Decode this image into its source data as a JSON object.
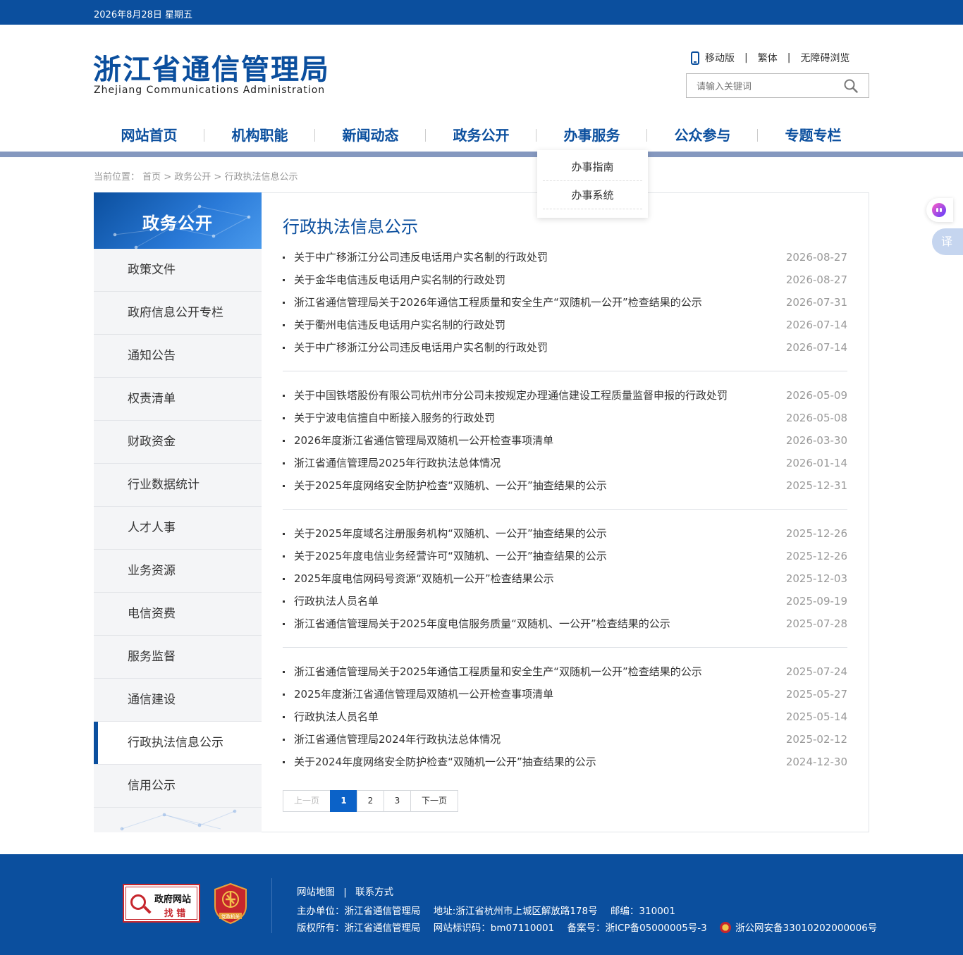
{
  "topbar": {
    "date": "2026年8月28日 星期五"
  },
  "header": {
    "logo_cn": "浙江省通信管理局",
    "logo_en": "Zhejiang Communications Administration",
    "links": {
      "mobile": "移动版",
      "traditional": "繁体",
      "accessible": "无障碍浏览"
    },
    "search_placeholder": "请输入关键词"
  },
  "nav": {
    "items": [
      "网站首页",
      "机构职能",
      "新闻动态",
      "政务公开",
      "办事服务",
      "公众参与",
      "专题专栏"
    ],
    "dropdown": [
      "办事指南",
      "办事系统"
    ]
  },
  "breadcrumb": "当前位置： 首页 > 政务公开 > 行政执法信息公示",
  "sidebar": {
    "title": "政务公开",
    "items": [
      "政策文件",
      "政府信息公开专栏",
      "通知公告",
      "权责清单",
      "财政资金",
      "行业数据统计",
      "人才人事",
      "业务资源",
      "电信资费",
      "服务监督",
      "通信建设",
      "行政执法信息公示",
      "信用公示"
    ],
    "active_index": 11
  },
  "main": {
    "title": "行政执法信息公示",
    "groups": [
      [
        {
          "title": "关于中广移浙江分公司违反电话用户实名制的行政处罚",
          "date": "2026-08-27"
        },
        {
          "title": "关于金华电信违反电话用户实名制的行政处罚",
          "date": "2026-08-27"
        },
        {
          "title": "浙江省通信管理局关于2026年通信工程质量和安全生产“双随机一公开”检查结果的公示",
          "date": "2026-07-31"
        },
        {
          "title": "关于衢州电信违反电话用户实名制的行政处罚",
          "date": "2026-07-14"
        },
        {
          "title": "关于中广移浙江分公司违反电话用户实名制的行政处罚",
          "date": "2026-07-14"
        }
      ],
      [
        {
          "title": "关于中国铁塔股份有限公司杭州市分公司未按规定办理通信建设工程质量监督申报的行政处罚",
          "date": "2026-05-09"
        },
        {
          "title": "关于宁波电信擅自中断接入服务的行政处罚",
          "date": "2026-05-08"
        },
        {
          "title": "2026年度浙江省通信管理局双随机一公开检查事项清单",
          "date": "2026-03-30"
        },
        {
          "title": "浙江省通信管理局2025年行政执法总体情况",
          "date": "2026-01-14"
        },
        {
          "title": "关于2025年度网络安全防护检查“双随机、一公开”抽查结果的公示",
          "date": "2025-12-31"
        }
      ],
      [
        {
          "title": "关于2025年度域名注册服务机构“双随机、一公开”抽查结果的公示",
          "date": "2025-12-26"
        },
        {
          "title": "关于2025年度电信业务经营许可“双随机、一公开”抽查结果的公示",
          "date": "2025-12-26"
        },
        {
          "title": "2025年度电信网码号资源“双随机一公开”检查结果公示",
          "date": "2025-12-03"
        },
        {
          "title": "行政执法人员名单",
          "date": "2025-09-19"
        },
        {
          "title": "浙江省通信管理局关于2025年度电信服务质量“双随机、一公开”检查结果的公示",
          "date": "2025-07-28"
        }
      ],
      [
        {
          "title": "浙江省通信管理局关于2025年通信工程质量和安全生产“双随机一公开”检查结果的公示",
          "date": "2025-07-24"
        },
        {
          "title": "2025年度浙江省通信管理局双随机一公开检查事项清单",
          "date": "2025-05-27"
        },
        {
          "title": "行政执法人员名单",
          "date": "2025-05-14"
        },
        {
          "title": "浙江省通信管理局2024年行政执法总体情况",
          "date": "2025-02-12"
        },
        {
          "title": "关于2024年度网络安全防护检查“双随机一公开”抽查结果的公示",
          "date": "2024-12-30"
        }
      ]
    ],
    "pager": {
      "prev": "上一页",
      "pages": [
        "1",
        "2",
        "3"
      ],
      "current": "1",
      "next": "下一页"
    }
  },
  "floating": {
    "translate": "译"
  },
  "footer": {
    "badge_find_l1": "政府网站",
    "badge_find_l2": "找 错",
    "badge_party": "党政机关",
    "links": {
      "sitemap": "网站地图",
      "contact": "联系方式"
    },
    "line1": {
      "host": "主办单位：浙江省通信管理局",
      "address": "地址:浙江省杭州市上城区解放路178号",
      "zip": "邮编：310001"
    },
    "line2": {
      "copyright": "版权所有：浙江省通信管理局",
      "site_id": "网站标识码：bm07110001",
      "icp": "备案号：浙ICP备05000005号-3",
      "police": "浙公网安备33010202000006号"
    }
  },
  "colors": {
    "brand": "#0b4f9e",
    "active_page": "#0b62c8",
    "nav_line": "#8598bf"
  }
}
